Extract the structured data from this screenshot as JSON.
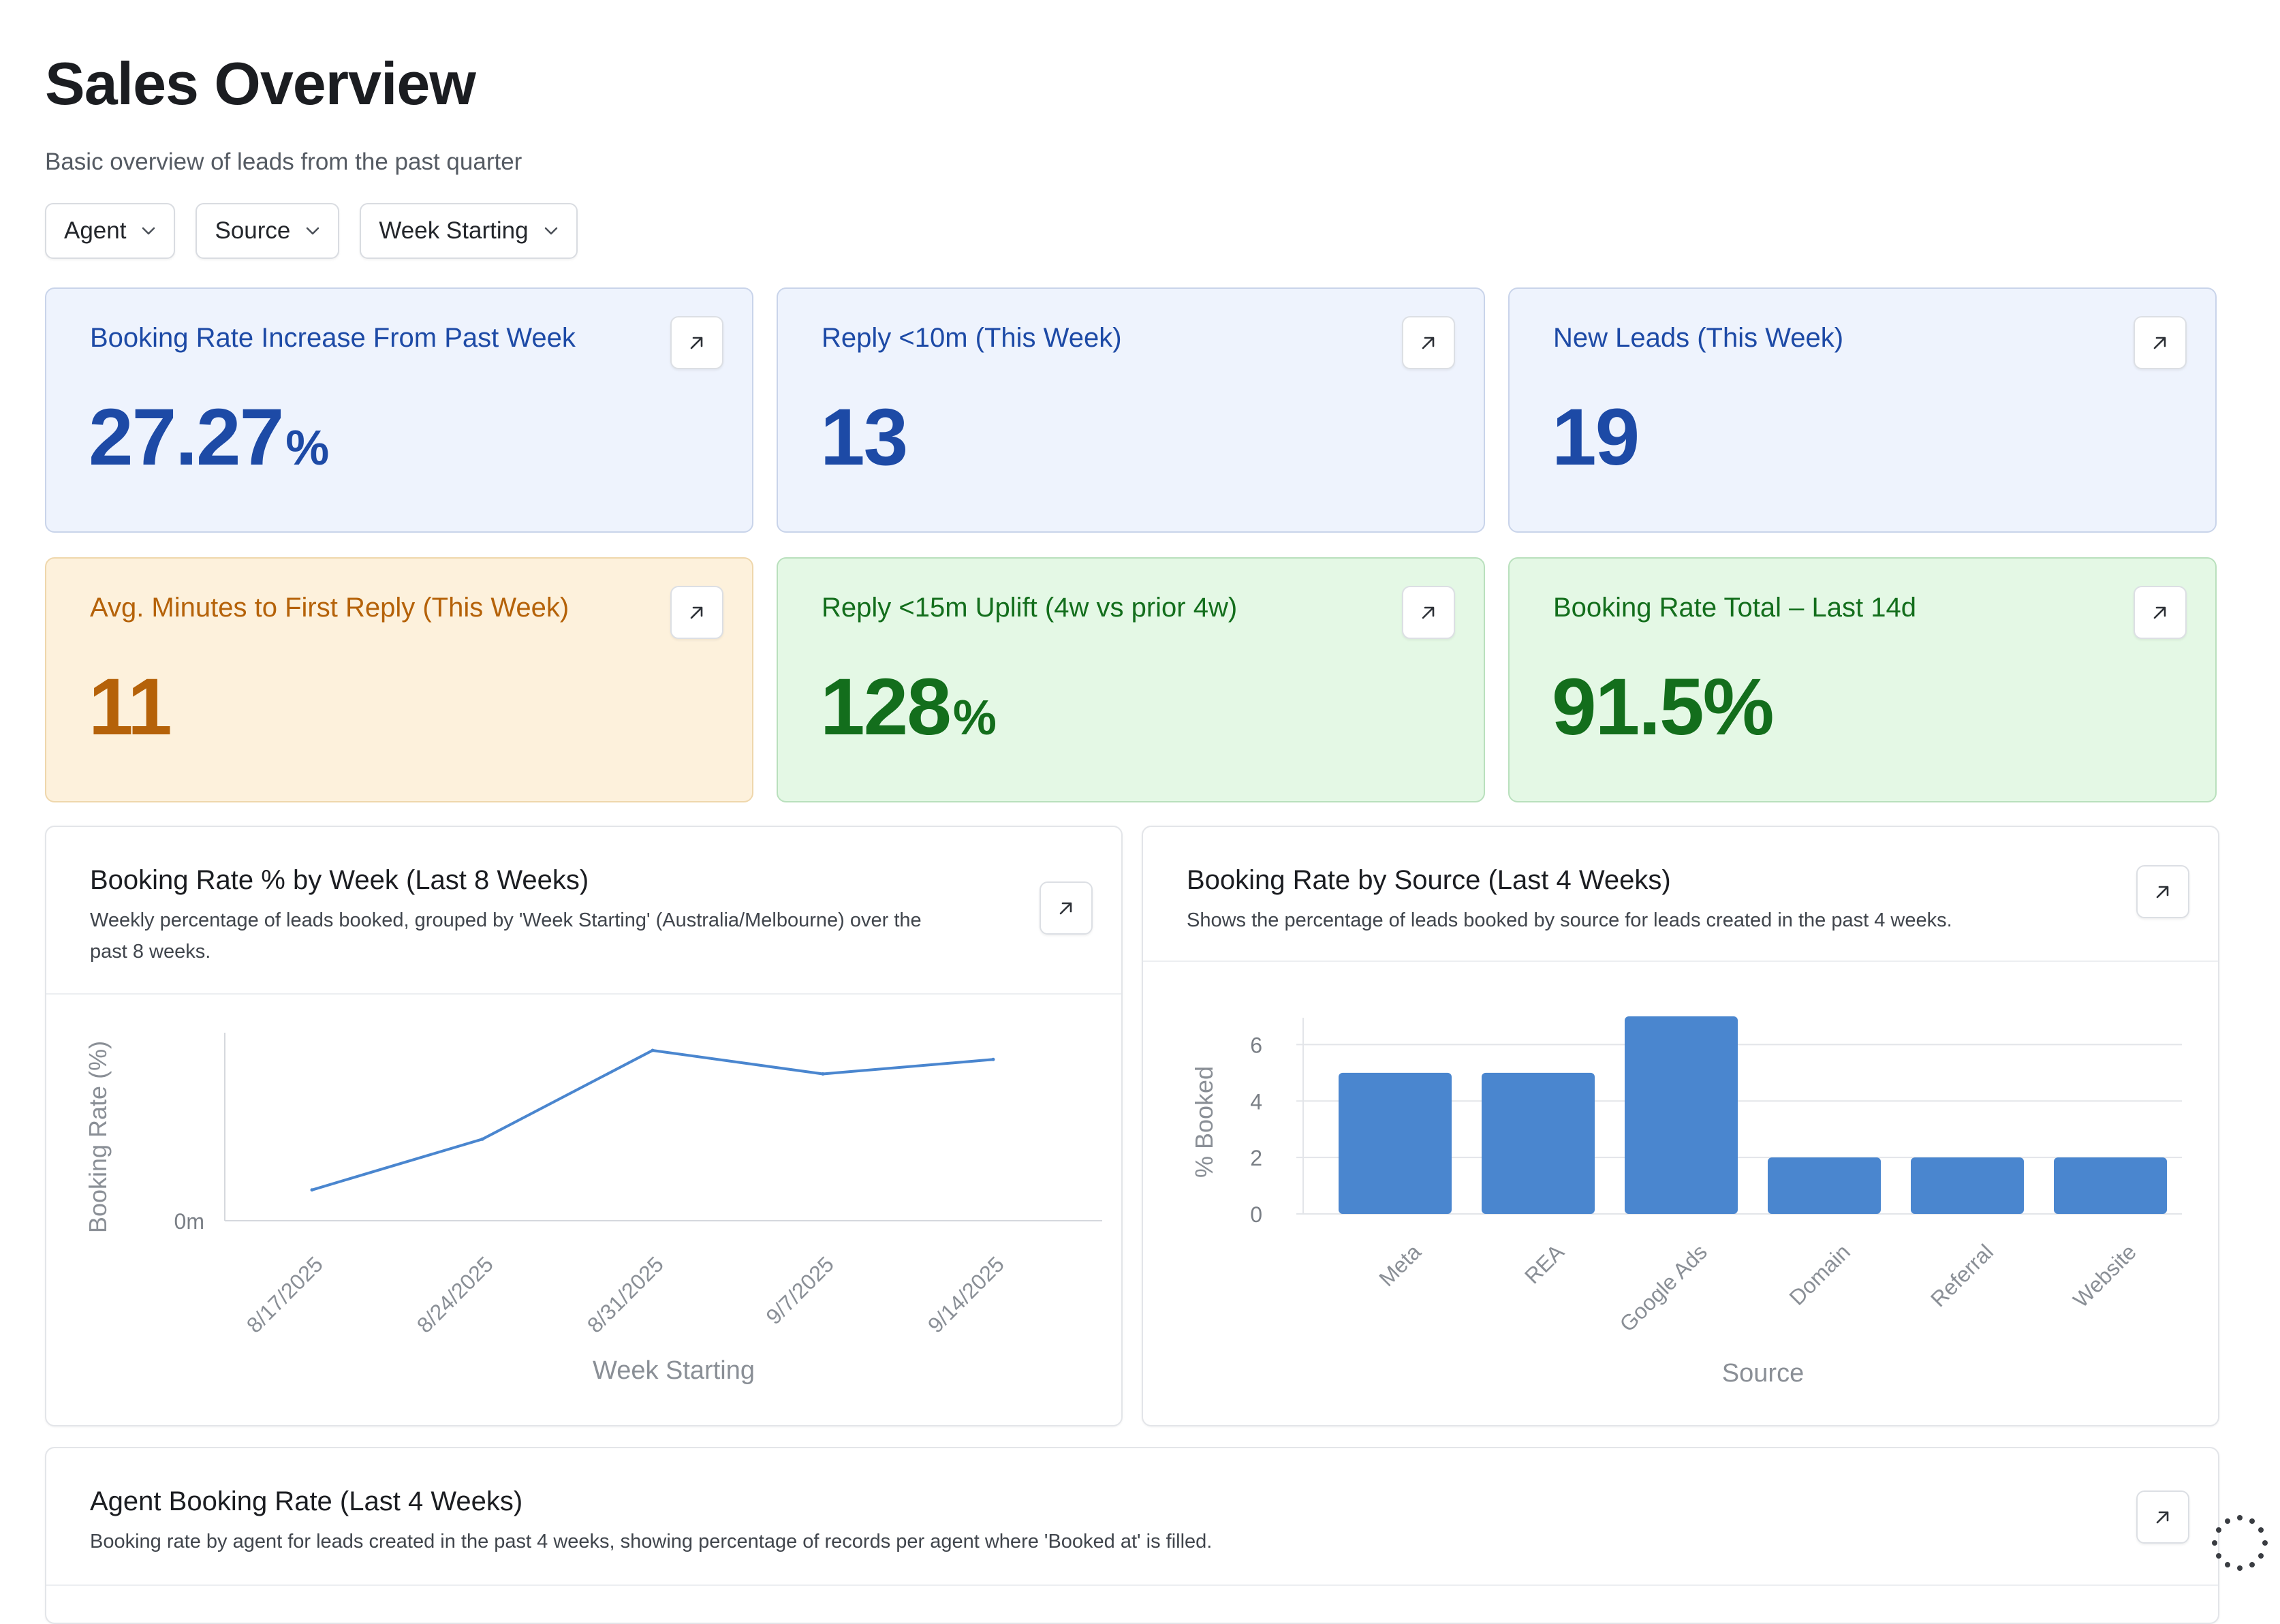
{
  "page": {
    "title": "Sales Overview",
    "subtitle": "Basic overview of leads from the past quarter"
  },
  "filters": [
    {
      "label": "Agent"
    },
    {
      "label": "Source"
    },
    {
      "label": "Week Starting"
    }
  ],
  "kpis": [
    {
      "label": "Booking Rate Increase From Past Week",
      "value": "27.27",
      "unit": "%",
      "theme": "blue"
    },
    {
      "label": "Reply <10m (This Week)",
      "value": "13",
      "unit": "",
      "theme": "blue"
    },
    {
      "label": "New Leads (This Week)",
      "value": "19",
      "unit": "",
      "theme": "blue"
    },
    {
      "label": "Avg. Minutes to First Reply (This Week)",
      "value": "11",
      "unit": "",
      "theme": "orange"
    },
    {
      "label": "Reply <15m Uplift (4w vs prior 4w)",
      "value": "128",
      "unit": "%",
      "theme": "green"
    },
    {
      "label": "Booking Rate Total – Last 14d",
      "value": "91.5%",
      "unit": "",
      "theme": "green"
    }
  ],
  "colors": {
    "blue_text": "#1d4aa6",
    "orange_text": "#b56209",
    "green_text": "#136e1c",
    "chart_blue": "#4a86cf"
  },
  "panels": {
    "weekly": {
      "title": "Booking Rate % by Week (Last 8 Weeks)",
      "desc_line1": "Weekly percentage of leads booked, grouped by 'Week Starting' (Australia/Melbourne) over the",
      "desc_line2": "past 8 weeks."
    },
    "source": {
      "title": "Booking Rate by Source (Last 4 Weeks)",
      "desc": "Shows the percentage of leads booked by source for leads created in the past 4 weeks."
    },
    "agent": {
      "title": "Agent Booking Rate (Last 4 Weeks)",
      "desc": "Booking rate by agent for leads created in the past 4 weeks, showing percentage of records per agent where 'Booked at' is filled."
    }
  },
  "chart_data": [
    {
      "type": "line",
      "title": "Booking Rate % by Week (Last 8 Weeks)",
      "xlabel": "Week Starting",
      "ylabel": "Booking Rate (%)",
      "y_tick_labels": [
        "0m"
      ],
      "categories": [
        "8/17/2025",
        "8/24/2025",
        "8/31/2025",
        "9/7/2025",
        "9/14/2025"
      ],
      "values": [
        0.17,
        0.45,
        0.94,
        0.81,
        0.89
      ],
      "ylim": [
        0,
        1
      ],
      "grid": false
    },
    {
      "type": "bar",
      "title": "Booking Rate by Source (Last 4 Weeks)",
      "xlabel": "Source",
      "ylabel": "% Booked",
      "categories": [
        "Meta",
        "REA",
        "Google Ads",
        "Domain",
        "Referral",
        "Website"
      ],
      "values": [
        5,
        5,
        7,
        2,
        2,
        2
      ],
      "ylim": [
        0,
        7
      ],
      "yticks": [
        0,
        2,
        4,
        6
      ],
      "grid": true
    }
  ]
}
